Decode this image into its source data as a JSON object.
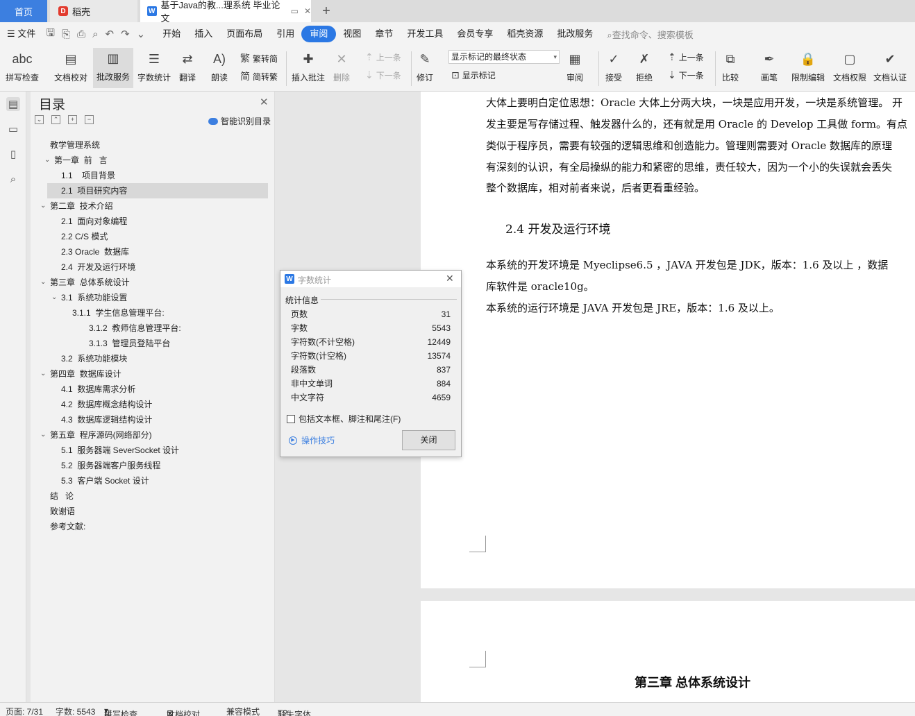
{
  "tabs": {
    "home": "首页",
    "daoke": "稻壳",
    "doc_title": "基于Java的教...理系统 毕业论文",
    "add": "+"
  },
  "menu": {
    "file": "文件",
    "items": [
      "开始",
      "插入",
      "页面布局",
      "引用",
      "审阅",
      "视图",
      "章节",
      "开发工具",
      "会员专享",
      "稻壳资源",
      "批改服务"
    ],
    "active": "审阅",
    "search": "查找命令、搜索模板"
  },
  "ribbon": {
    "spell": "拼写检查",
    "doc_check": "文档校对",
    "correct_service": "批改服务",
    "word_count": "字数统计",
    "translate": "翻译",
    "read_aloud": "朗读",
    "to_traditional": "繁转简",
    "to_simplified": "简转繁",
    "insert_comment": "插入批注",
    "delete": "删除",
    "prev": "上一条",
    "next": "下一条",
    "revise": "修订",
    "markup_state": "显示标记的最终状态",
    "show_markup": "显示标记",
    "review": "审阅",
    "accept": "接受",
    "reject": "拒绝",
    "prev2": "上一条",
    "next2": "下一条",
    "compare": "比较",
    "pen": "画笔",
    "restrict_edit": "限制编辑",
    "doc_permission": "文档权限",
    "doc_cert": "文档认证"
  },
  "toc": {
    "title": "目录",
    "smart": "智能识别目录",
    "items": [
      {
        "text": "教学管理系统",
        "indent": 0,
        "caret": ""
      },
      {
        "text": "第一章  前   言",
        "indent": 1,
        "caret": "v"
      },
      {
        "text": "1.1    项目背景",
        "indent": 2,
        "caret": ""
      },
      {
        "text": "2.1  项目研究内容",
        "indent": 2,
        "caret": "",
        "hl": true
      },
      {
        "text": "第二章  技术介绍",
        "indent": 0,
        "caret": "v"
      },
      {
        "text": "2.1  面向对象编程",
        "indent": 2,
        "caret": ""
      },
      {
        "text": "2.2 C/S 模式",
        "indent": 2,
        "caret": ""
      },
      {
        "text": "2.3 Oracle  数据库",
        "indent": 2,
        "caret": ""
      },
      {
        "text": "2.4  开发及运行环境",
        "indent": 2,
        "caret": ""
      },
      {
        "text": "第三章  总体系统设计",
        "indent": 0,
        "caret": "v"
      },
      {
        "text": "3.1  系统功能设置",
        "indent": 2,
        "caret": "v"
      },
      {
        "text": "3.1.1  学生信息管理平台:",
        "indent": 3,
        "caret": ""
      },
      {
        "text": "3.1.2  教师信息管理平台:",
        "indent": 4,
        "caret": ""
      },
      {
        "text": "3.1.3  管理员登陆平台",
        "indent": 4,
        "caret": ""
      },
      {
        "text": "3.2  系统功能模块",
        "indent": 2,
        "caret": ""
      },
      {
        "text": "第四章  数据库设计",
        "indent": 0,
        "caret": "v"
      },
      {
        "text": "4.1  数据库需求分析",
        "indent": 2,
        "caret": ""
      },
      {
        "text": "4.2  数据库概念结构设计",
        "indent": 2,
        "caret": ""
      },
      {
        "text": "4.3  数据库逻辑结构设计",
        "indent": 2,
        "caret": ""
      },
      {
        "text": "第五章  程序源码(网络部分)",
        "indent": 0,
        "caret": "v"
      },
      {
        "text": "5.1  服务器端 SeverSocket 设计",
        "indent": 2,
        "caret": ""
      },
      {
        "text": "5.2  服务器端客户服务线程",
        "indent": 2,
        "caret": ""
      },
      {
        "text": "5.3  客户端 Socket 设计",
        "indent": 2,
        "caret": ""
      },
      {
        "text": "结   论",
        "indent": 0,
        "caret": ""
      },
      {
        "text": "致谢语",
        "indent": 0,
        "caret": ""
      },
      {
        "text": "参考文献:",
        "indent": 0,
        "caret": ""
      }
    ]
  },
  "doc": {
    "lines": [
      "大体上要明白定位思想：Oracle 大体上分两大块，一块是应用开发，一块是系统管理。 开",
      "发主要是写存储过程、触发器什么的，还有就是用 Oracle 的 Develop 工具做 form。有点",
      "类似于程序员，需要有较强的逻辑思维和创造能力。管理则需要对 Oracle 数据库的原理",
      "有深刻的认识，有全局操纵的能力和紧密的思维，责任较大，因为一个小的失误就会丢失",
      "整个数据库，相对前者来说，后者更看重经验。"
    ],
    "heading_24": "2.4  开发及运行环境",
    "env_lines": [
      "    本系统的开发环境是 Myeclipse6.5 ，JAVA 开发包是 JDK，版本：1.6 及以上 ，数据",
      "库软件是 oracle10g。",
      "    本系统的运行环境是 JAVA 开发包是 JRE，版本：1.6 及以上。"
    ],
    "chapter3": "第三章  总体系统设计"
  },
  "dialog": {
    "title": "字数统计",
    "section": "统计信息",
    "stats": [
      {
        "label": "页数",
        "value": "31"
      },
      {
        "label": "字数",
        "value": "5543"
      },
      {
        "label": "字符数(不计空格)",
        "value": "12449"
      },
      {
        "label": "字符数(计空格)",
        "value": "13574"
      },
      {
        "label": "段落数",
        "value": "837"
      },
      {
        "label": "非中文单词",
        "value": "884"
      },
      {
        "label": "中文字符",
        "value": "4659"
      }
    ],
    "include_label": "包括文本框、脚注和尾注(F)",
    "tips": "操作技巧",
    "close": "关闭"
  },
  "status": {
    "page": "页面: 7/31",
    "words": "字数: 5543",
    "spell": "拼写检查",
    "doc_check": "文档校对",
    "compat": "兼容模式",
    "missing_font": "缺失字体"
  }
}
